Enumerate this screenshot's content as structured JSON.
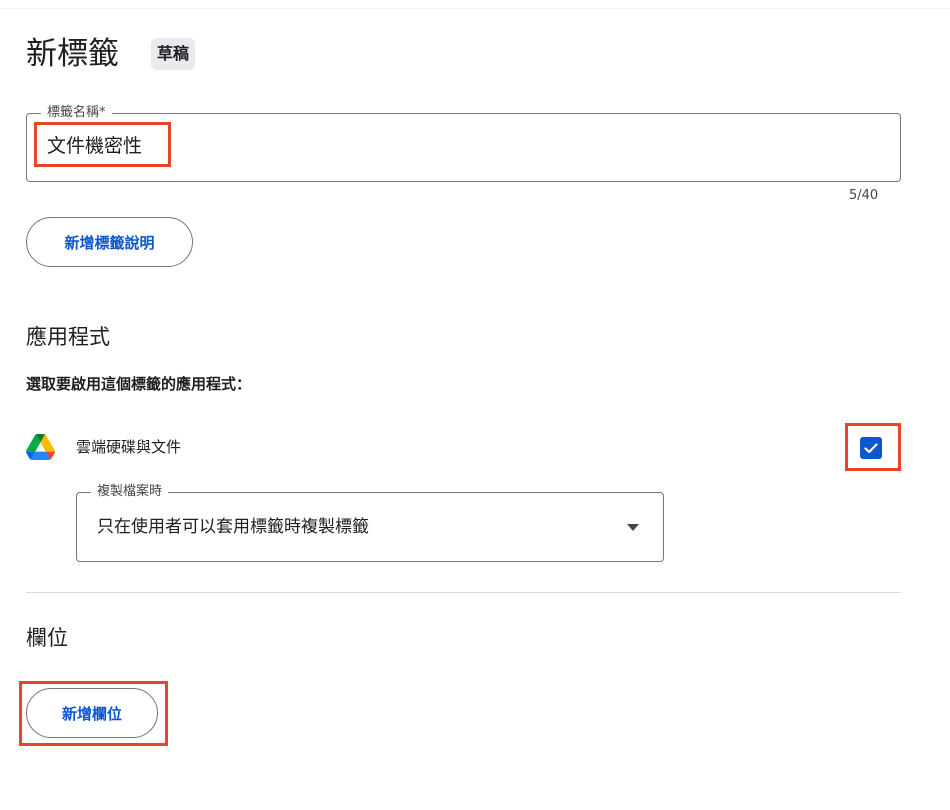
{
  "header": {
    "title": "新標籤",
    "badge": "草稿"
  },
  "label_name": {
    "label": "標籤名稱*",
    "value": "文件機密性",
    "counter": "5/40"
  },
  "add_description_button": "新增標籤說明",
  "apps_section": {
    "heading": "應用程式",
    "subtitle": "選取要啟用這個標籤的應用程式：",
    "apps": [
      {
        "name": "雲端硬碟與文件",
        "icon": "google-drive-icon",
        "checked": true
      }
    ],
    "copy_setting": {
      "label": "複製檔案時",
      "selected": "只在使用者可以套用標籤時複製標籤"
    }
  },
  "fields_section": {
    "heading": "欄位",
    "add_field_button": "新增欄位"
  },
  "colors": {
    "accent": "#0b57d0",
    "highlight": "#e8442a",
    "badge_bg": "#e8eaed"
  }
}
